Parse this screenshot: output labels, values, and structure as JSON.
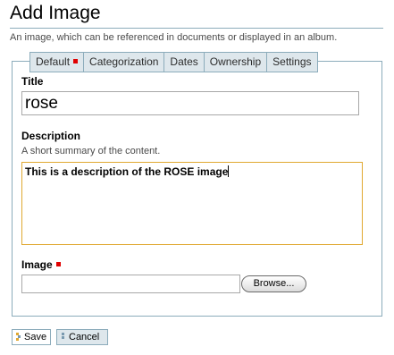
{
  "page": {
    "title": "Add Image",
    "subtitle": "An image, which can be referenced in documents or displayed in an album."
  },
  "tabs": [
    {
      "label": "Default",
      "active": true,
      "required": true
    },
    {
      "label": "Categorization"
    },
    {
      "label": "Dates"
    },
    {
      "label": "Ownership"
    },
    {
      "label": "Settings"
    }
  ],
  "fields": {
    "title": {
      "label": "Title",
      "value": "rose"
    },
    "description": {
      "label": "Description",
      "help": "A short summary of the content.",
      "value": "This is a description of the ROSE image"
    },
    "image": {
      "label": "Image",
      "required": true,
      "browse_label": "Browse..."
    }
  },
  "actions": {
    "save_label": "Save",
    "cancel_label": "Cancel"
  },
  "colors": {
    "required_marker": "#e00000",
    "tab_bg": "#dee7ec",
    "border": "#8cacbb",
    "focus_border": "#e0a830"
  }
}
